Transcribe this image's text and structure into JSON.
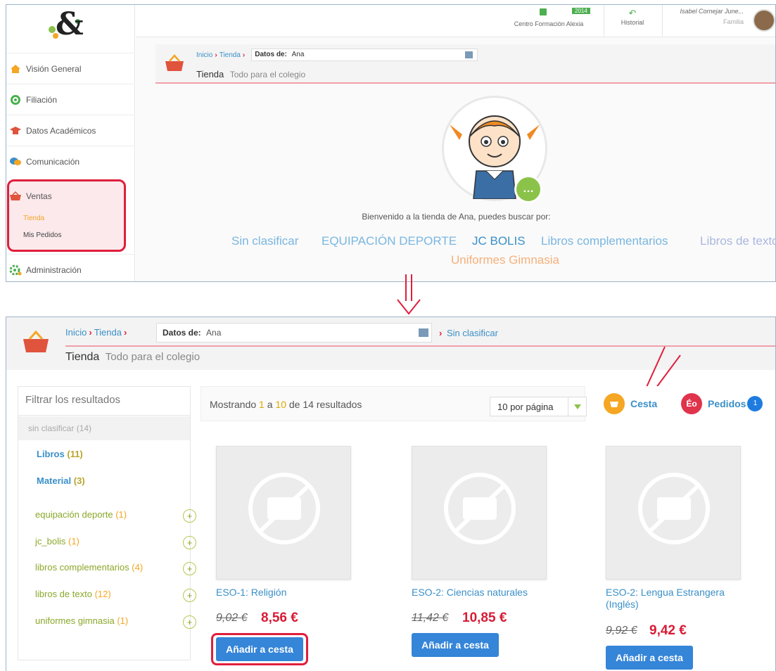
{
  "top": {
    "sidebar": {
      "items": [
        {
          "label": "Visión General",
          "icon": "home-icon"
        },
        {
          "label": "Filiación",
          "icon": "target-icon"
        },
        {
          "label": "Datos Académicos",
          "icon": "graduation-cap-icon"
        },
        {
          "label": "Comunicación",
          "icon": "chat-icon"
        },
        {
          "label": "Ventas",
          "icon": "basket-icon"
        },
        {
          "label": "Administración",
          "icon": "gear-icon"
        }
      ],
      "sub_items": [
        "Tienda",
        "Mis Pedidos"
      ]
    },
    "topbar": {
      "centro_label": "Centro Formación Alexia",
      "badge": "2014",
      "historial_label": "Historial",
      "user_name": "Isabel Cornejar June...",
      "user_role": "Familia"
    },
    "breadcrumb": {
      "inicio": "Inicio",
      "tienda": "Tienda",
      "datos_label": "Datos de:",
      "datos_value": "Ana",
      "title": "Tienda",
      "subtitle": "Todo para el colegio"
    },
    "welcome": "Bienvenido a la tienda de Ana, puedes buscar por:",
    "categories": [
      "Sin clasificar",
      "EQUIPACIÓN DEPORTE",
      "JC BOLIS",
      "Libros complementarios",
      "Libros de texto",
      "Uniformes Gimnasia"
    ]
  },
  "bottom": {
    "breadcrumb": {
      "inicio": "Inicio",
      "tienda": "Tienda",
      "datos_label": "Datos de:",
      "datos_value": "Ana",
      "extra": "Sin clasificar",
      "title": "Tienda",
      "subtitle": "Todo para el colegio"
    },
    "filter": {
      "title": "Filtrar los resultados",
      "selected": "sin clasificar",
      "selected_count": "(14)",
      "sub": [
        {
          "label": "Libros",
          "count": "(11)"
        },
        {
          "label": "Material",
          "count": "(3)"
        }
      ],
      "categories": [
        {
          "label": "equipación deporte",
          "count": "(1)"
        },
        {
          "label": "jc_bolis",
          "count": "(1)"
        },
        {
          "label": "libros complementarios",
          "count": "(4)"
        },
        {
          "label": "libros de texto",
          "count": "(12)"
        },
        {
          "label": "uniformes gimnasia",
          "count": "(1)"
        }
      ]
    },
    "results": {
      "prefix": "Mostrando",
      "from": "1",
      "a": "a",
      "to": "10",
      "de": "de",
      "total": "14",
      "suffix": "resultados",
      "per_page": "10 por página"
    },
    "cart": {
      "cesta_label": "Cesta",
      "pedidos_label": "Pedidos",
      "pedidos_badge": "1",
      "pedidos_icon_text": "Éo"
    },
    "products": [
      {
        "name": "ESO-1: Religión",
        "old_price": "9,02 €",
        "price": "8,56 €",
        "button": "Añadir a cesta"
      },
      {
        "name": "ESO-2: Ciencias naturales",
        "old_price": "11,42 €",
        "price": "10,85 €",
        "button": "Añadir a cesta"
      },
      {
        "name": "ESO-2: Lengua Estrangera (Inglés)",
        "old_price": "9,92 €",
        "price": "9,42 €",
        "button": "Añadir a cesta"
      }
    ]
  },
  "colors": {
    "accent_blue": "#3585d8",
    "highlight_red": "#e01e3c",
    "price_red": "#d81b35",
    "link_blue": "#3a8fc8",
    "filter_green": "#8aa82a"
  }
}
